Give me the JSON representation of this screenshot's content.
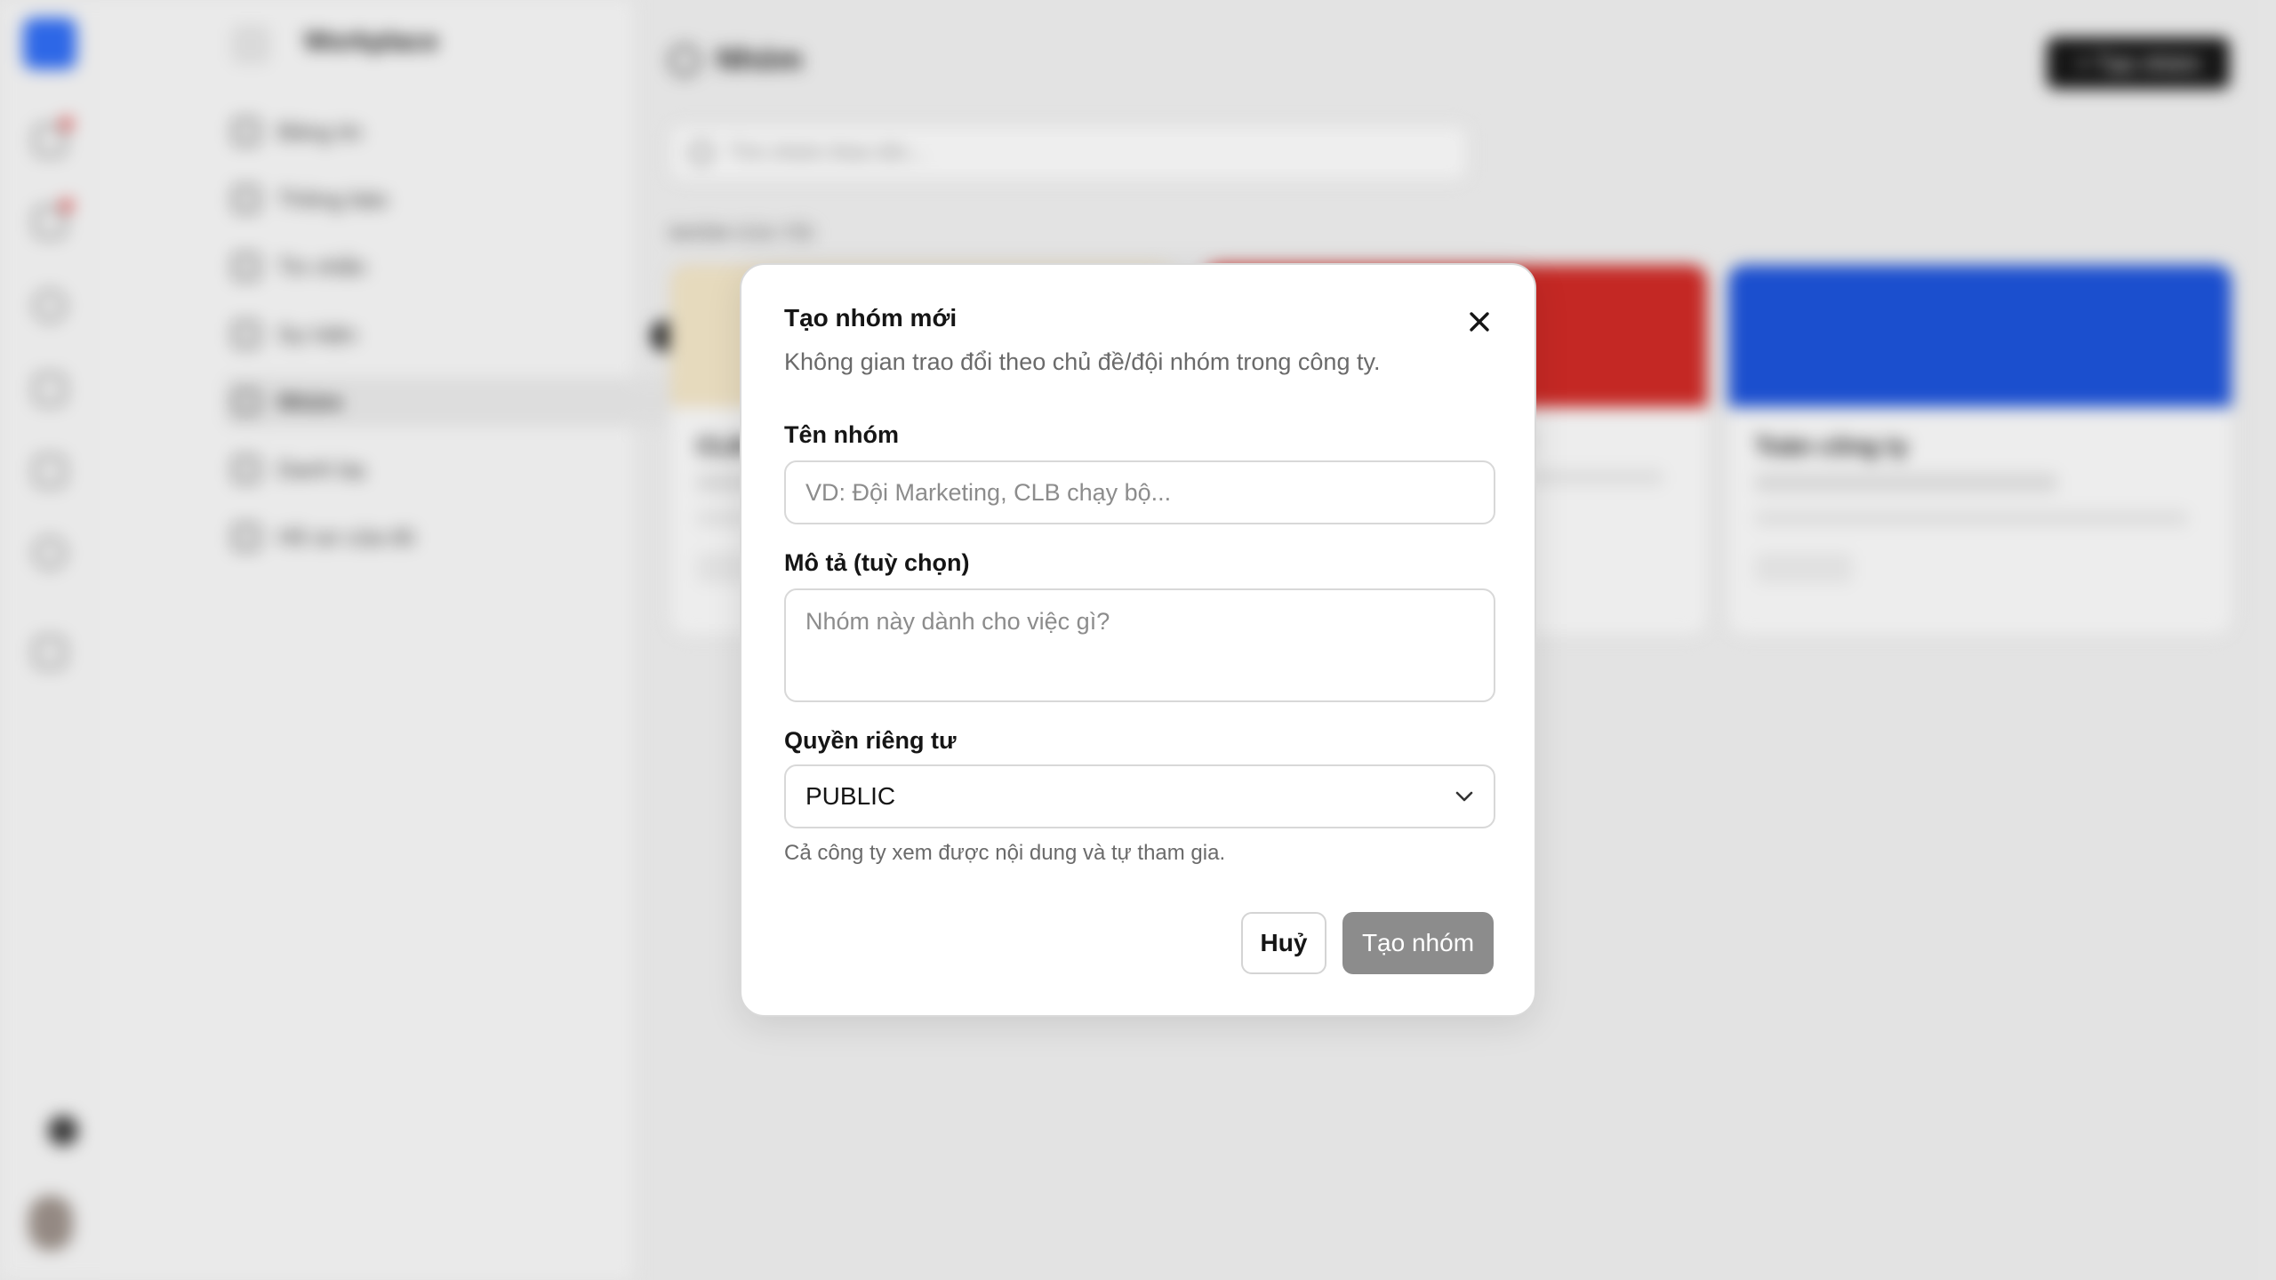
{
  "background": {
    "workspace_name": "Workplace",
    "page_title": "Nhóm",
    "create_button_label": "+ Tạo nhóm",
    "search_placeholder": "Tìm nhóm theo tên...",
    "section_label": "NHÓM CỦA TÔI",
    "nav_items": [
      "Bảng tin",
      "Thông báo",
      "Tin nhắn",
      "Sự kiện",
      "Nhóm",
      "Danh bạ",
      "Hồ sơ của tôi"
    ],
    "cards": [
      {
        "title": "CLB",
        "banner_color": "#efe2c4"
      },
      {
        "title": "",
        "banner_color": "#cc2a26"
      },
      {
        "title": "Toàn công ty",
        "banner_color": "#1d52d6"
      }
    ]
  },
  "modal": {
    "title": "Tạo nhóm mới",
    "subtitle": "Không gian trao đổi theo chủ đề/đội nhóm trong công ty.",
    "name_label": "Tên nhóm",
    "name_placeholder": "VD: Đội Marketing, CLB chạy bộ...",
    "name_value": "",
    "description_label": "Mô tả (tuỳ chọn)",
    "description_placeholder": "Nhóm này dành cho việc gì?",
    "description_value": "",
    "privacy_label": "Quyền riêng tư",
    "privacy_value": "PUBLIC",
    "privacy_hint": "Cả công ty xem được nội dung và tự tham gia.",
    "cancel_label": "Huỷ",
    "submit_label": "Tạo nhóm",
    "submit_color": "#8c8c8c"
  }
}
